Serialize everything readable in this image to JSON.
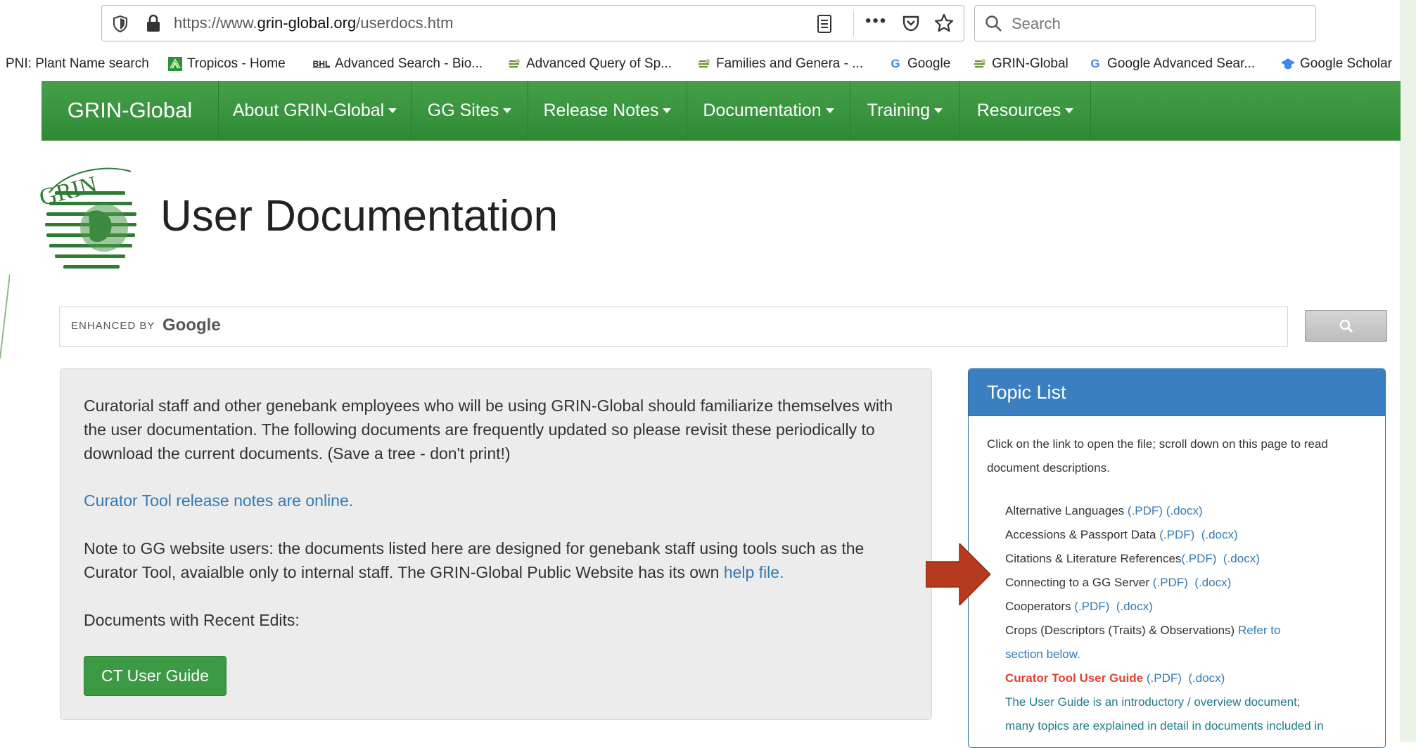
{
  "browser": {
    "url_prefix": "https://www.",
    "url_host": "grin-global.org",
    "url_path": "/userdocs.htm",
    "more_label": "•••",
    "search_placeholder": "Search"
  },
  "bookmarks": [
    {
      "label": "PNI: Plant Name search",
      "icon": ""
    },
    {
      "label": "Tropicos - Home",
      "icon": "tropicos-icon"
    },
    {
      "label": "Advanced Search - Bio...",
      "icon": "bhl-icon",
      "icon_text": "BHL"
    },
    {
      "label": "Advanced Query of Sp...",
      "icon": "grin-icon"
    },
    {
      "label": "Families and Genera - ...",
      "icon": "grin-icon"
    },
    {
      "label": "Google",
      "icon": "google-icon",
      "icon_text": "G"
    },
    {
      "label": "GRIN-Global",
      "icon": "grin-icon"
    },
    {
      "label": "Google Advanced Sear...",
      "icon": "google-icon",
      "icon_text": "G"
    },
    {
      "label": "Google Scholar",
      "icon": "scholar-icon"
    }
  ],
  "nav": {
    "brand": "GRIN-Global",
    "items": [
      "About GRIN-Global",
      "GG Sites",
      "Release Notes",
      "Documentation",
      "Training",
      "Resources"
    ]
  },
  "header": {
    "title": "User Documentation"
  },
  "google_search": {
    "enhanced_by": "ENHANCED BY",
    "google": "Google"
  },
  "main": {
    "intro": "Curatorial staff and other genebank employees who will be using GRIN-Global should familiarize themselves with the user documentation. The following documents are frequently updated so please revisit these periodically to download the current documents. (Save a tree - don't print!)",
    "release_link": "Curator Tool release notes are online.",
    "note_text": "Note to GG website users: the documents listed here are designed for genebank staff using tools such as the Curator Tool, avaialble only to internal staff. The GRIN-Global Public Website has its own ",
    "help_link": "help file.",
    "recent_label": "Documents with Recent Edits:",
    "ct_button": "CT User Guide"
  },
  "topic_panel": {
    "title": "Topic List",
    "intro": "Click on the link to open the file; scroll down on this page to read document descriptions.",
    "items": [
      {
        "label": "Alternative Languages ",
        "pdf": "(.PDF)",
        "docx": "(.docx)"
      },
      {
        "label": "Accessions & Passport Data ",
        "pdf": "(.PDF)",
        "docx": "(.docx)"
      },
      {
        "label": "Citations & Literature References",
        "pdf": "(.PDF)",
        "docx": "(.docx)"
      },
      {
        "label": "Connecting to a GG Server ",
        "pdf": "(.PDF)",
        "docx": "(.docx)"
      },
      {
        "label": "Cooperators ",
        "pdf": "(.PDF)",
        "docx": "(.docx)"
      },
      {
        "label": "Crops (Descriptors (Traits) & Observations) ",
        "refer": "Refer to"
      },
      {
        "label": "section below."
      },
      {
        "label": "Curator Tool User Guide",
        "pdf": "(.PDF)",
        "docx": "(.docx)"
      },
      {
        "label": "The User Guide is an introductory / overview document;"
      },
      {
        "label": "many topics are explained in detail in documents included in"
      }
    ]
  },
  "colors": {
    "nav_green": "#3a9540",
    "panel_blue": "#3a7fc0",
    "link_blue": "#337ab7",
    "arrow_red": "#b53a1e",
    "highlight_red": "#e5412e"
  }
}
